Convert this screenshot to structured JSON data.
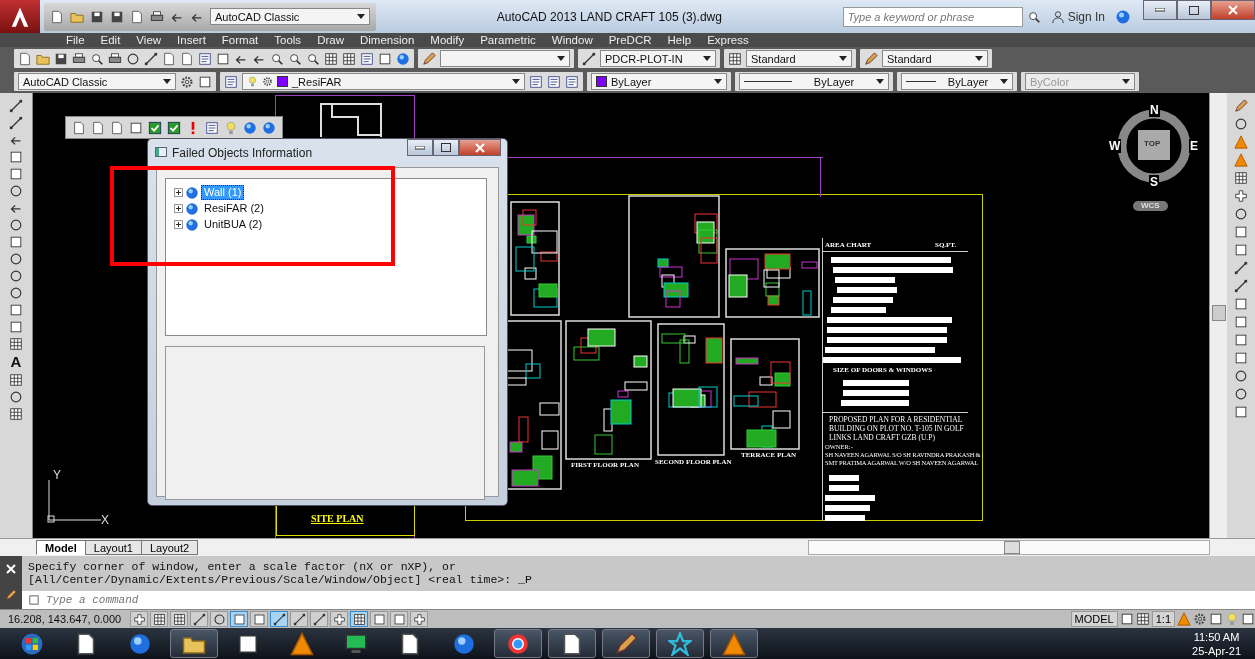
{
  "title_bar": {
    "workspace": "AutoCAD Classic",
    "title": "AutoCAD 2013    LAND CRAFT 105 (3).dwg",
    "search": {
      "placeholder": "Type a keyword or phrase"
    },
    "sign_in": "Sign In"
  },
  "menu": [
    "File",
    "Edit",
    "View",
    "Insert",
    "Format",
    "Tools",
    "Draw",
    "Dimension",
    "Modify",
    "Parametric",
    "Window",
    "PreDCR",
    "Help",
    "Express"
  ],
  "toolbar_1": {
    "dim_style": "PDCR-PLOT-IN",
    "table_style": "Standard",
    "multileader_style": "Standard"
  },
  "toolbar_2": {
    "workspace": "AutoCAD Classic",
    "layer": "_ResiFAR",
    "color_setting": "ByLayer",
    "linetype": "ByLayer",
    "lineweight": "ByLayer",
    "plot_style": {
      "value": "ByColor",
      "disabled": true
    }
  },
  "left_toolbar": {
    "text_tool": "A"
  },
  "dialog": {
    "title": "Failed Objects Information",
    "tree": [
      {
        "label": "Wall (1)",
        "selected": true,
        "expanded": false
      },
      {
        "label": "ResiFAR (2)",
        "selected": false,
        "expanded": false
      },
      {
        "label": "UnitBUA (2)",
        "selected": false,
        "expanded": false
      }
    ]
  },
  "drawing": {
    "site_plan": "SITE PLAN",
    "area_chart": "AREA CHART",
    "unit": "SQ.FT.",
    "doors_windows": "SIZE OF DOORS & WINDOWS",
    "proposal": [
      "PROPOSED PLAN FOR A RESIDENTIAL",
      "BUILDING ON PLOT NO. T-105 IN GOLF",
      "LINKS  LAND CRAFT  GZB (U.P)"
    ],
    "owner_heading": "OWNER:-",
    "owners": [
      "SH NAVEEN AGARWAL S/O SH RAVINDRA PRAKASH &",
      "SMT PRATIMA AGARWAL W/O SH NAVEEN AGARWAL"
    ],
    "plan_titles": [
      "FIRST FLOOR PLAN",
      "SECOND FLOOR PLAN",
      "TERRACE   PLAN"
    ]
  },
  "viewcube": {
    "north": "N",
    "south": "S",
    "east": "E",
    "west": "W",
    "face": "TOP",
    "ucs": "WCS"
  },
  "ucs_icon": {
    "y": "Y",
    "x": "X"
  },
  "layout_tabs": [
    {
      "label": "Model",
      "selected": true
    },
    {
      "label": "Layout1",
      "selected": false
    },
    {
      "label": "Layout2",
      "selected": false
    }
  ],
  "command_line": {
    "history": [
      "Specify corner of window, enter a scale factor (nX or nXP), or",
      "[All/Center/Dynamic/Extents/Previous/Scale/Window/Object] <real time>: _P"
    ],
    "placeholder": "Type a command"
  },
  "status_bar": {
    "coordinates": "16.208, 143.647, 0.000",
    "toggles": [
      {
        "on": false
      },
      {
        "on": false
      },
      {
        "on": false
      },
      {
        "on": false
      },
      {
        "on": false
      },
      {
        "on": true
      },
      {
        "on": false
      },
      {
        "on": true
      },
      {
        "on": false
      },
      {
        "on": false
      },
      {
        "on": false
      },
      {
        "on": true
      },
      {
        "on": false
      },
      {
        "on": false
      },
      {
        "on": false
      }
    ],
    "space": "MODEL",
    "scale": "1:1"
  },
  "taskbar": {
    "apps": [
      {
        "running": false
      },
      {
        "running": false
      },
      {
        "running": false
      },
      {
        "running": true
      },
      {
        "running": false
      },
      {
        "running": false
      },
      {
        "running": false
      },
      {
        "running": false
      },
      {
        "running": false
      },
      {
        "running": true
      },
      {
        "running": true
      },
      {
        "running": true
      },
      {
        "running": true
      },
      {
        "running": true
      }
    ],
    "time": "11:50 AM",
    "date": "25-Apr-21"
  }
}
